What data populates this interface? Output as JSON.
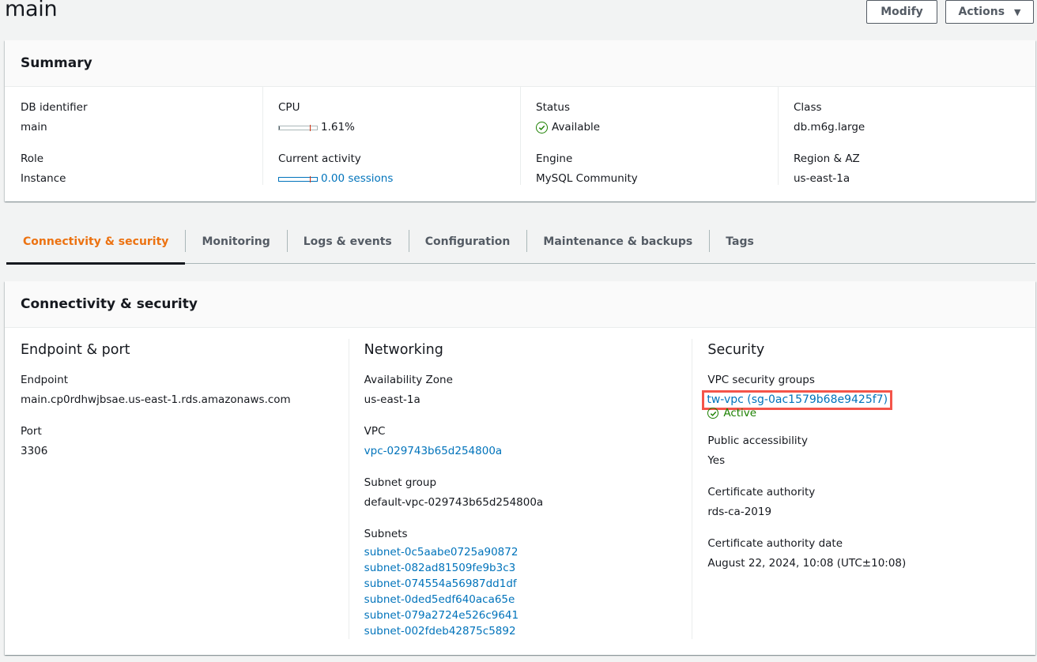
{
  "page": {
    "title": "main",
    "buttons": {
      "modify": "Modify",
      "actions": "Actions"
    }
  },
  "summary": {
    "title": "Summary",
    "db_identifier": {
      "label": "DB identifier",
      "value": "main"
    },
    "role": {
      "label": "Role",
      "value": "Instance"
    },
    "cpu": {
      "label": "CPU",
      "value": "1.61%",
      "percent": 1.61
    },
    "current_activity": {
      "label": "Current activity",
      "value": "0.00 sessions",
      "sessions": 0.0
    },
    "status": {
      "label": "Status",
      "value": "Available",
      "color": "#1d8102"
    },
    "engine": {
      "label": "Engine",
      "value": "MySQL Community"
    },
    "class": {
      "label": "Class",
      "value": "db.m6g.large"
    },
    "region_az": {
      "label": "Region & AZ",
      "value": "us-east-1a"
    }
  },
  "tabs": [
    {
      "label": "Connectivity & security",
      "active": true
    },
    {
      "label": "Monitoring",
      "active": false
    },
    {
      "label": "Logs & events",
      "active": false
    },
    {
      "label": "Configuration",
      "active": false
    },
    {
      "label": "Maintenance & backups",
      "active": false
    },
    {
      "label": "Tags",
      "active": false
    }
  ],
  "connectivity": {
    "title": "Connectivity & security",
    "endpoint_port": {
      "heading": "Endpoint & port",
      "endpoint": {
        "label": "Endpoint",
        "value": "main.cp0rdhwjbsae.us-east-1.rds.amazonaws.com"
      },
      "port": {
        "label": "Port",
        "value": "3306"
      }
    },
    "networking": {
      "heading": "Networking",
      "availability_zone": {
        "label": "Availability Zone",
        "value": "us-east-1a"
      },
      "vpc": {
        "label": "VPC",
        "value": "vpc-029743b65d254800a"
      },
      "subnet_group": {
        "label": "Subnet group",
        "value": "default-vpc-029743b65d254800a"
      },
      "subnets": {
        "label": "Subnets",
        "items": [
          "subnet-0c5aabe0725a90872",
          "subnet-082ad81509fe9b3c3",
          "subnet-074554a56987dd1df",
          "subnet-0ded5edf640aca65e",
          "subnet-079a2724e526c9641",
          "subnet-002fdeb42875c5892"
        ]
      }
    },
    "security": {
      "heading": "Security",
      "vpc_security_groups": {
        "label": "VPC security groups",
        "value": "tw-vpc (sg-0ac1579b68e9425f7)",
        "status": "Active"
      },
      "public_accessibility": {
        "label": "Public accessibility",
        "value": "Yes"
      },
      "certificate_authority": {
        "label": "Certificate authority",
        "value": "rds-ca-2019"
      },
      "certificate_authority_date": {
        "label": "Certificate authority date",
        "value": "August 22, 2024, 10:08 (UTC±10:08)"
      }
    }
  },
  "colors": {
    "accent_orange": "#ec7211",
    "link_blue": "#0073bb",
    "success_green": "#1d8102",
    "highlight_red": "#f4554a"
  }
}
